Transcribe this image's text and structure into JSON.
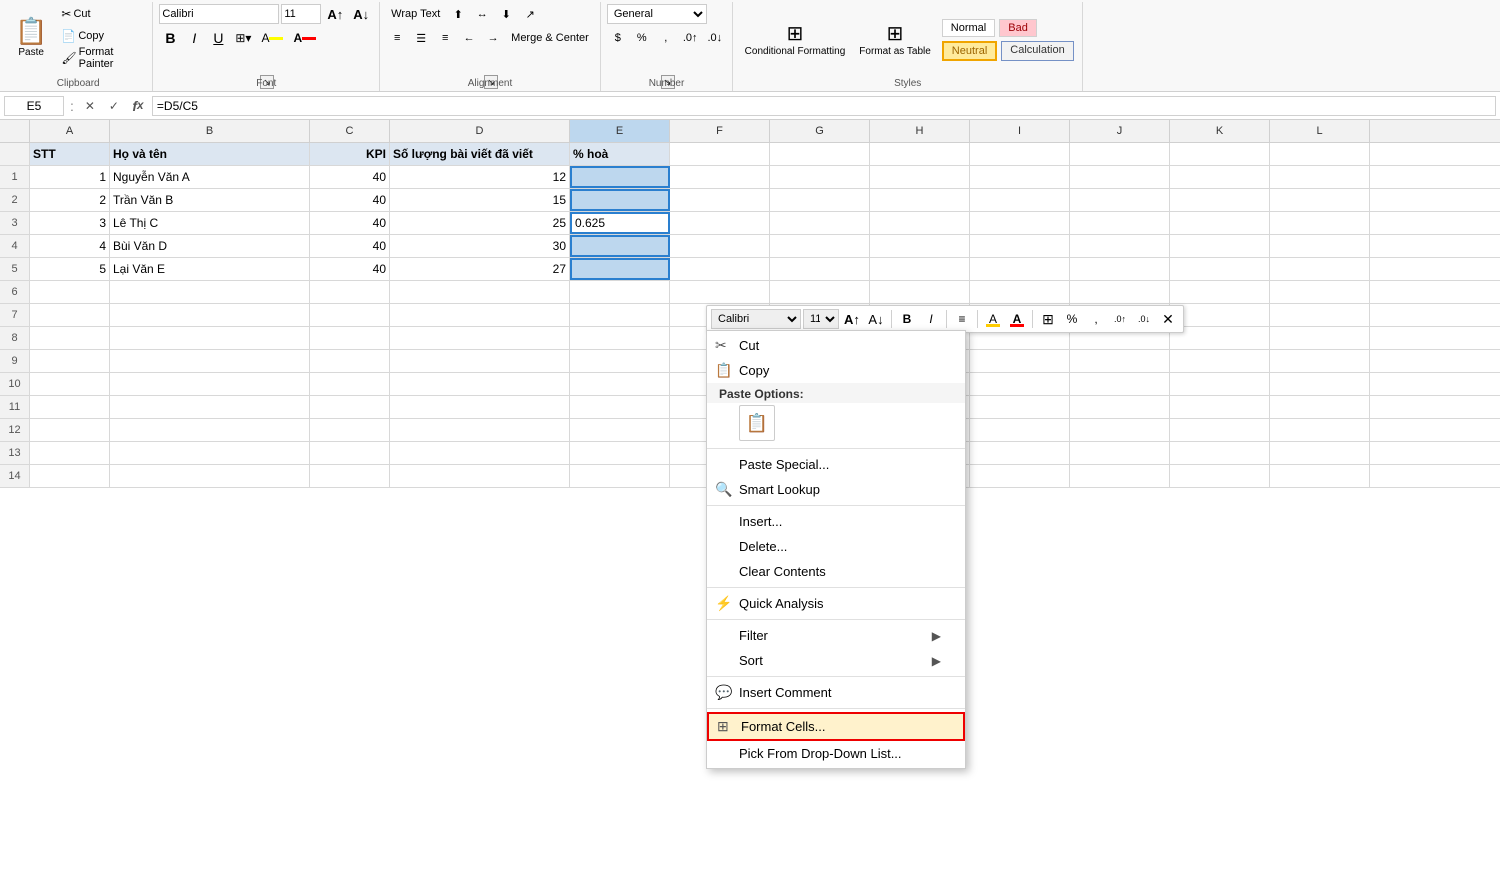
{
  "ribbon": {
    "clipboard": {
      "label": "Clipboard",
      "cut": "Cut",
      "copy": "Copy",
      "format_painter": "Format Painter",
      "paste": "Paste"
    },
    "font": {
      "label": "Font",
      "font_name": "Calibri",
      "font_size": "11",
      "bold": "B",
      "italic": "I",
      "underline": "U"
    },
    "alignment": {
      "label": "Alignment",
      "wrap_text": "Wrap Text",
      "merge_center": "Merge & Center"
    },
    "number": {
      "label": "Number",
      "format": "General"
    },
    "styles": {
      "label": "Styles",
      "conditional_formatting": "Conditional Formatting",
      "format_as_table": "Format as Table",
      "normal": "Normal",
      "bad": "Bad",
      "neutral": "Neutral",
      "calculation": "Calculation"
    }
  },
  "formula_bar": {
    "cell_ref": "E5",
    "formula": "=D5/C5"
  },
  "columns": [
    "A",
    "B",
    "C",
    "D",
    "E",
    "F",
    "G",
    "H",
    "I",
    "J",
    "K",
    "L"
  ],
  "headers": [
    "STT",
    "Họ và tên",
    "KPI",
    "Số lượng bài viết đã viết",
    "% hoà"
  ],
  "rows": [
    {
      "num": "",
      "a": "STT",
      "b": "Họ và tên",
      "c": "KPI",
      "d": "Số lượng bài viết đã viết",
      "e": "% hoà",
      "is_header": true
    },
    {
      "num": "1",
      "a": "1",
      "b": "Nguyễn Văn A",
      "c": "40",
      "d": "12",
      "e": "",
      "is_header": false
    },
    {
      "num": "2",
      "a": "2",
      "b": "Trần Văn B",
      "c": "40",
      "d": "15",
      "e": "",
      "is_header": false
    },
    {
      "num": "3",
      "a": "3",
      "b": "Lê Thị C",
      "c": "40",
      "d": "25",
      "e": "0.625",
      "is_header": false
    },
    {
      "num": "4",
      "a": "4",
      "b": "Bùi Văn D",
      "c": "40",
      "d": "30",
      "e": "",
      "is_header": false
    },
    {
      "num": "5",
      "a": "5",
      "b": "Lại Văn E",
      "c": "40",
      "d": "27",
      "e": "",
      "is_header": false
    }
  ],
  "mini_toolbar": {
    "font": "Calibri",
    "size": "11"
  },
  "context_menu": {
    "cut": "Cut",
    "copy": "Copy",
    "paste_options": "Paste Options:",
    "paste_special": "Paste Special...",
    "smart_lookup": "Smart Lookup",
    "insert": "Insert...",
    "delete": "Delete...",
    "clear_contents": "Clear Contents",
    "quick_analysis": "Quick Analysis",
    "filter": "Filter",
    "sort": "Sort",
    "insert_comment": "Insert Comment",
    "format_cells": "Format Cells...",
    "pick_from_dropdown": "Pick From Drop-Down List..."
  }
}
